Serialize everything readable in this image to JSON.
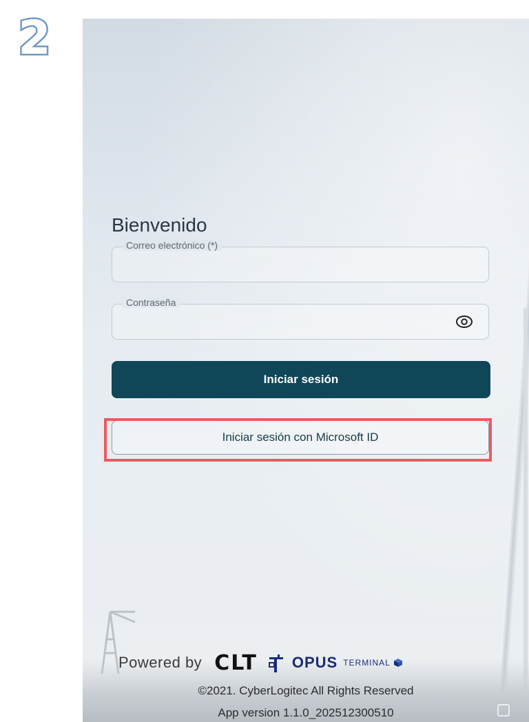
{
  "step_number": "2",
  "login": {
    "title": "Bienvenido",
    "email_label": "Correo electrónico (*)",
    "email_value": "",
    "password_label": "Contraseña",
    "password_value": "",
    "submit_label": "Iniciar sesión",
    "microsoft_label": "Iniciar sesión con Microsoft ID"
  },
  "footer": {
    "powered_by": "Powered by",
    "brand_clt": "CLT",
    "brand_opus": "OPUS",
    "brand_terminal": "TERMINAL",
    "copyright": "©2021. CyberLogitec All Rights Reserved",
    "version": "App version 1.1.0_202512300510"
  },
  "icons": {
    "password_toggle": "eye-icon",
    "crane_logo": "crane-icon",
    "terminal_cube": "cube-icon"
  },
  "colors": {
    "primary_button": "#0f4758",
    "highlight": "#ec5a5f",
    "badge": "#6f99c4",
    "opus_brand": "#1a2a78"
  }
}
